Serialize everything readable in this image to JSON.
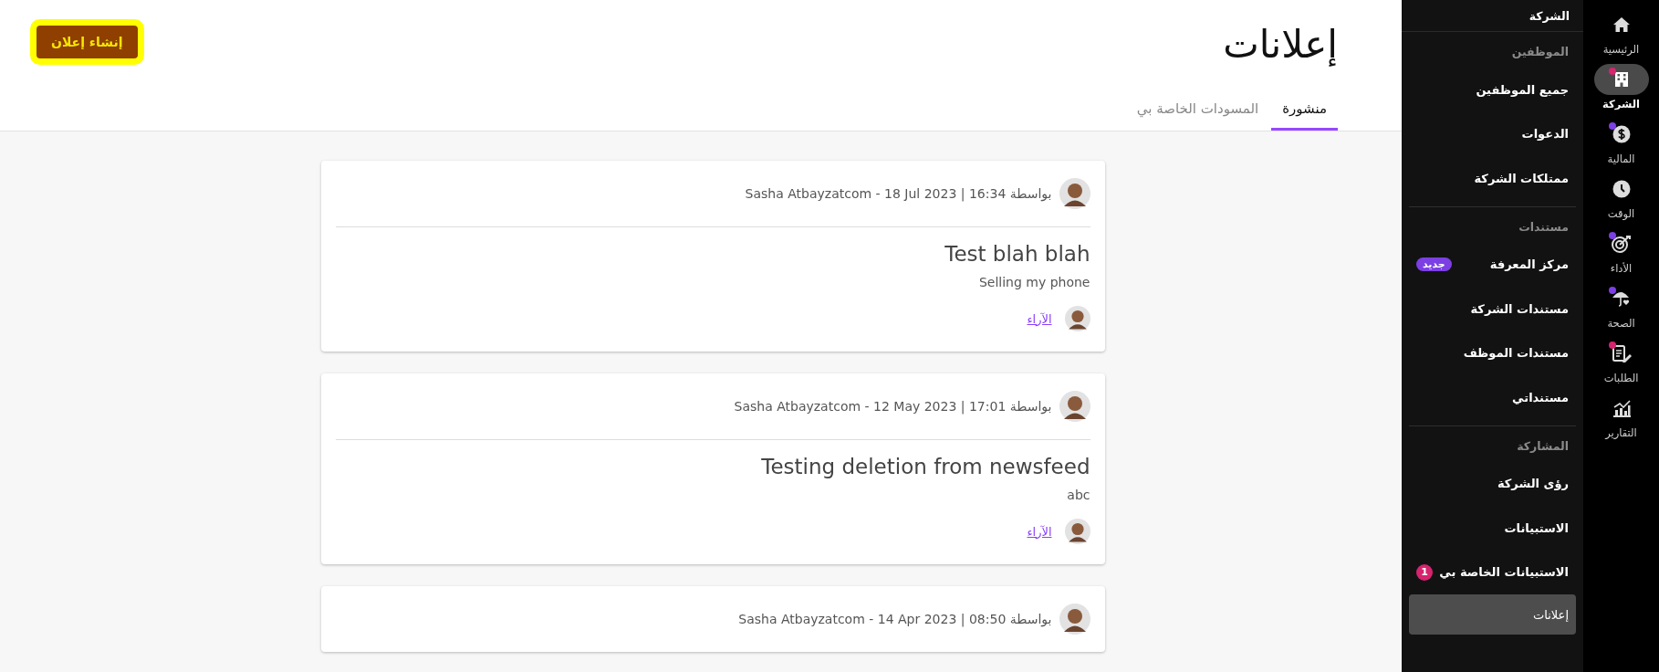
{
  "rail": [
    {
      "kind": "home",
      "label": "الرئيسية",
      "selected": false
    },
    {
      "kind": "building",
      "label": "الشركة",
      "selected": true,
      "color": "#d6246e"
    },
    {
      "kind": "dollar",
      "label": "المالية",
      "selected": false,
      "color": "#7b3fe4"
    },
    {
      "kind": "clock",
      "label": "الوقت",
      "selected": false
    },
    {
      "kind": "target",
      "label": "الأداء",
      "selected": false,
      "color": "#7b3fe4"
    },
    {
      "kind": "umbrella",
      "label": "الصحة",
      "selected": false,
      "color": "#7b3fe4"
    },
    {
      "kind": "clipboard",
      "label": "الطلبات",
      "selected": false,
      "color": "#d6246e"
    },
    {
      "kind": "chart",
      "label": "التقارير",
      "selected": false
    }
  ],
  "sidebar": {
    "title": "الشركة",
    "sections": [
      {
        "label": "الموظفين",
        "items": [
          {
            "label": "جميع الموظفين",
            "selected": false
          },
          {
            "label": "الدعوات",
            "selected": false
          },
          {
            "label": "ممتلكات الشركة",
            "selected": false
          }
        ]
      },
      {
        "label": "مستندات",
        "items": [
          {
            "label": "مركز المعرفة",
            "selected": false,
            "badge": {
              "text": "جديد",
              "kind": "tag"
            }
          },
          {
            "label": "مستندات الشركة",
            "selected": false
          },
          {
            "label": "مستندات الموظف",
            "selected": false
          },
          {
            "label": "مستنداتي",
            "selected": false
          }
        ]
      },
      {
        "label": "المشاركة",
        "items": [
          {
            "label": "رؤى الشركة",
            "selected": false
          },
          {
            "label": "الاستبيانات",
            "selected": false
          },
          {
            "label": "الاستبيانات الخاصة بي",
            "selected": false,
            "badge": {
              "text": "1",
              "kind": "count"
            }
          },
          {
            "label": "إعلانات",
            "selected": true
          }
        ]
      }
    ]
  },
  "header": {
    "title": "إعلانات",
    "create_button": "إنشاء إعلان"
  },
  "tabs": [
    {
      "label": "منشورة",
      "selected": true
    },
    {
      "label": "المسودات الخاصة بي",
      "selected": false
    }
  ],
  "posts": [
    {
      "byline": "بواسطة Sasha Atbayzatcom - 18 Jul 2023 | 16:34",
      "title": "Test blah blah",
      "body": "Selling my phone",
      "views_link": "الآراء"
    },
    {
      "byline": "بواسطة Sasha Atbayzatcom - 12 May 2023 | 17:01",
      "title": "Testing deletion from newsfeed",
      "body": "abc",
      "views_link": "الآراء"
    },
    {
      "byline": "بواسطة Sasha Atbayzatcom - 14 Apr 2023 | 08:50"
    }
  ]
}
